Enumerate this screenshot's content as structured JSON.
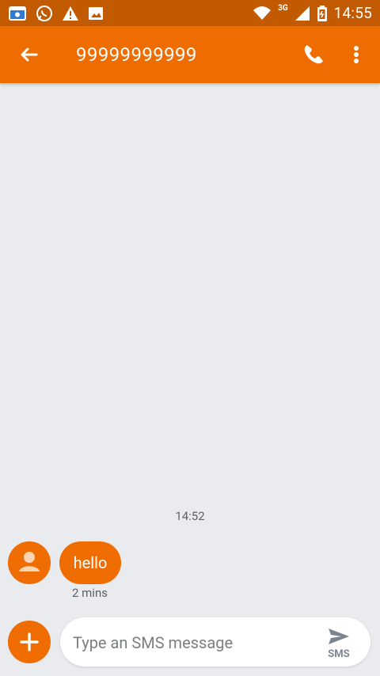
{
  "status_bar": {
    "time": "14:55",
    "network": "3G",
    "left_icons": [
      "calendar-icon",
      "whatsapp-icon",
      "warning-icon",
      "image-icon"
    ],
    "right_icons": [
      "wifi-icon",
      "signal-icon",
      "battery-icon"
    ]
  },
  "app_bar": {
    "title": "99999999999",
    "icons": [
      "arrow-left-icon",
      "phone-icon",
      "more-vert-icon"
    ]
  },
  "conversation": {
    "timestamp": "14:52",
    "messages": [
      {
        "text": "hello",
        "meta": "2 mins"
      }
    ]
  },
  "compose": {
    "placeholder": "Type an SMS message",
    "send_label": "SMS"
  },
  "colors": {
    "accent": "#ef6c00",
    "status_bar": "#c15a00",
    "background": "#e9ebee",
    "secondary_text": "#5d6164"
  }
}
